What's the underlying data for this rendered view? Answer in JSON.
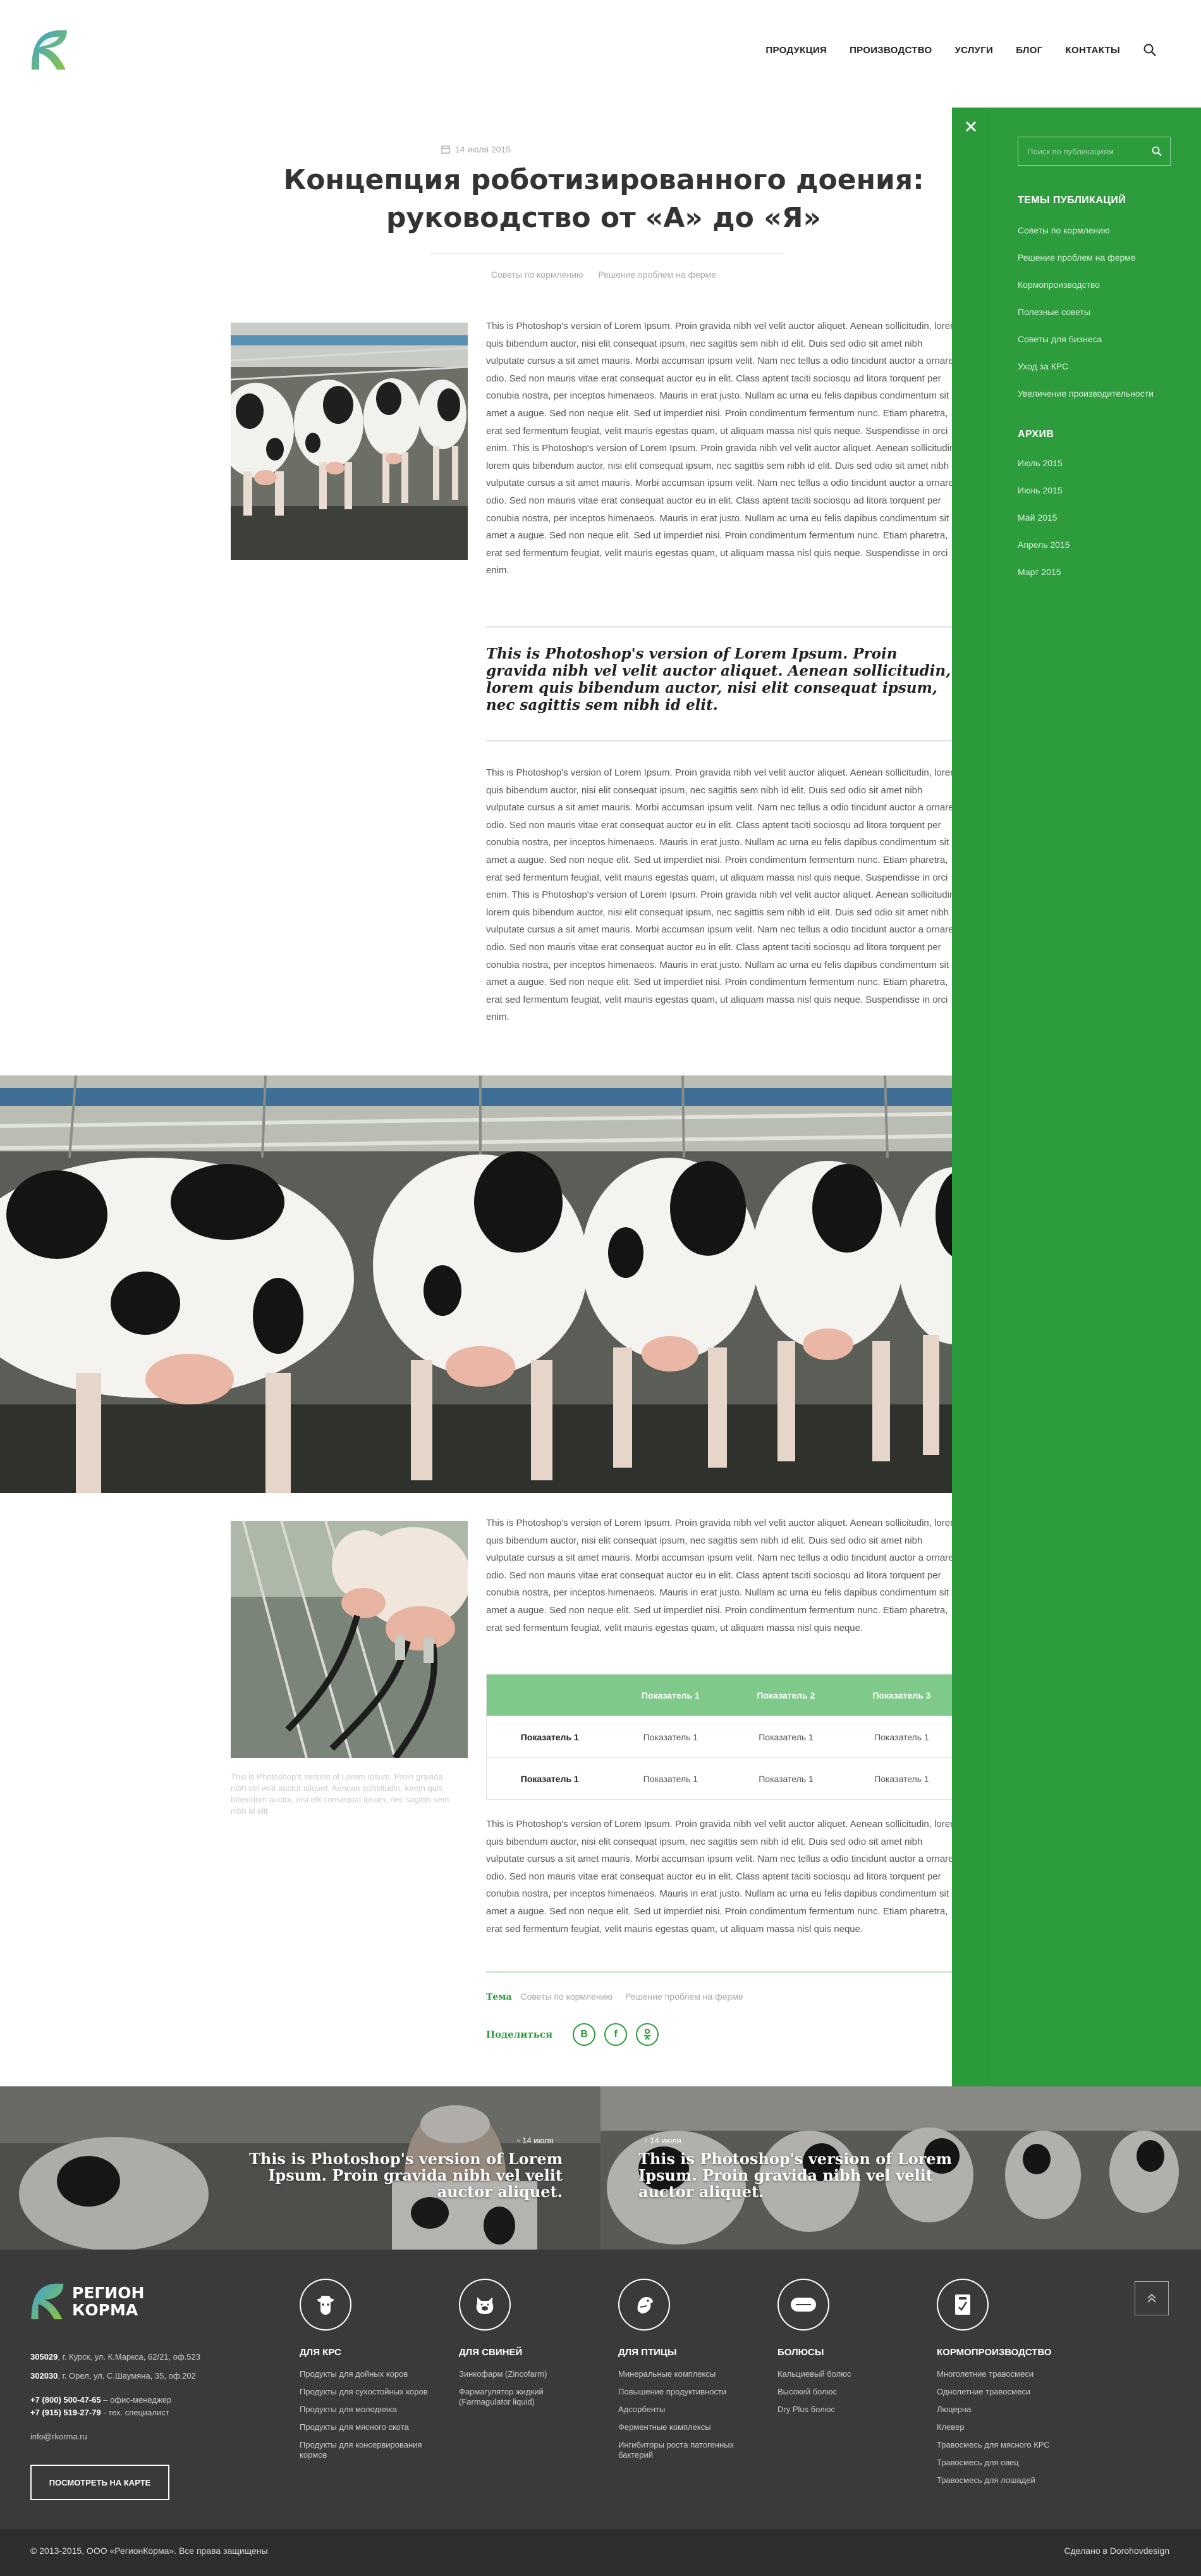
{
  "header": {
    "nav": [
      "ПРОДУКЦИЯ",
      "ПРОИЗВОДСТВО",
      "УСЛУГИ",
      "БЛОГ",
      "КОНТАКТЫ"
    ]
  },
  "article": {
    "date": "14 июля 2015",
    "title_1": "Концепция роботизированного доения:",
    "title_2": "руководство от «А» до «Я»",
    "tags": [
      "Советы по кормлению",
      "Решение проблем на ферме"
    ],
    "para_1": "This is Photoshop's version  of Lorem Ipsum. Proin gravida nibh vel velit auctor aliquet. Aenean sollicitudin, lorem quis bibendum auctor, nisi elit consequat ipsum, nec sagittis sem nibh id elit. Duis sed odio sit amet nibh vulputate cursus a sit amet mauris. Morbi accumsan ipsum velit. Nam nec tellus a odio tincidunt auctor a ornare odio. Sed non  mauris vitae erat consequat auctor eu in elit. Class aptent taciti sociosqu ad litora torquent per conubia nostra, per inceptos himenaeos. Mauris in erat justo. Nullam ac urna eu felis dapibus condimentum sit amet a augue. Sed non neque elit. Sed ut imperdiet nisi. Proin condimentum fermentum nunc. Etiam pharetra, erat sed fermentum feugiat, velit mauris egestas quam, ut aliquam massa nisl quis neque. Suspendisse in orci enim. This is Photoshop's version  of Lorem Ipsum. Proin gravida nibh vel velit auctor aliquet. Aenean sollicitudin, lorem quis bibendum auctor, nisi elit consequat ipsum, nec sagittis sem nibh id elit. Duis sed odio sit amet nibh vulputate cursus a sit amet mauris. Morbi accumsan ipsum velit. Nam nec tellus a odio tincidunt auctor a ornare odio. Sed non  mauris vitae erat consequat auctor eu in elit. Class aptent taciti sociosqu ad litora torquent per conubia nostra, per inceptos himenaeos. Mauris in erat justo. Nullam ac urna eu felis dapibus condimentum sit amet a augue. Sed non neque elit. Sed ut imperdiet nisi. Proin condimentum fermentum nunc. Etiam pharetra, erat sed fermentum feugiat, velit mauris egestas quam, ut aliquam massa nisl quis neque. Suspendisse in orci enim.",
    "quote": "This is Photoshop's version  of Lorem Ipsum. Proin gravida nibh vel velit auctor aliquet. Aenean sollicitudin, lorem quis bibendum auctor, nisi elit consequat ipsum, nec sagittis sem nibh id elit.",
    "para_2": "This is Photoshop's version  of Lorem Ipsum. Proin gravida nibh vel velit auctor aliquet. Aenean sollicitudin, lorem quis bibendum auctor, nisi elit consequat ipsum, nec sagittis sem nibh id elit. Duis sed odio sit amet nibh vulputate cursus a sit amet mauris. Morbi accumsan ipsum velit. Nam nec tellus a odio tincidunt auctor a ornare odio. Sed non  mauris vitae erat consequat auctor eu in elit. Class aptent taciti sociosqu ad litora torquent per conubia nostra, per inceptos himenaeos. Mauris in erat justo. Nullam ac urna eu felis dapibus condimentum sit amet a augue. Sed non neque elit. Sed ut imperdiet nisi. Proin condimentum fermentum nunc. Etiam pharetra, erat sed fermentum feugiat, velit mauris egestas quam, ut aliquam massa nisl quis neque. Suspendisse in orci enim. This is Photoshop's version  of Lorem Ipsum. Proin gravida nibh vel velit auctor aliquet. Aenean sollicitudin, lorem quis bibendum auctor, nisi elit consequat ipsum, nec sagittis sem nibh id elit. Duis sed odio sit amet nibh vulputate cursus a sit amet mauris. Morbi accumsan ipsum velit. Nam nec tellus a odio tincidunt auctor a ornare odio. Sed non  mauris vitae erat consequat auctor eu in elit. Class aptent taciti sociosqu ad litora torquent per conubia nostra, per inceptos himenaeos. Mauris in erat justo. Nullam ac urna eu felis dapibus condimentum sit amet a augue. Sed non neque elit. Sed ut imperdiet nisi. Proin condimentum fermentum nunc. Etiam pharetra, erat sed fermentum feugiat, velit mauris egestas quam, ut aliquam massa nisl quis neque. Suspendisse in orci enim.",
    "para_3": "This is Photoshop's version  of Lorem Ipsum. Proin gravida nibh vel velit auctor aliquet. Aenean sollicitudin, lorem quis bibendum auctor, nisi elit consequat ipsum, nec sagittis sem nibh id elit. Duis sed odio sit amet nibh vulputate cursus a sit amet mauris. Morbi accumsan ipsum velit. Nam nec tellus a odio tincidunt auctor a ornare odio. Sed non  mauris vitae erat consequat auctor eu in elit. Class aptent taciti sociosqu ad litora torquent per conubia nostra, per inceptos himenaeos. Mauris in erat justo. Nullam ac urna eu felis dapibus condimentum sit amet a augue. Sed non neque elit. Sed ut imperdiet nisi. Proin condimentum fermentum nunc. Etiam pharetra, erat sed fermentum feugiat, velit mauris egestas quam, ut aliquam massa nisl quis neque.",
    "caption": "This is Photoshop's version  of Lorem Ipsum. Proin gravida nibh vel velit auctor aliquet. Aenean sollicitudin, lorem quis bibendum auctor, nisi elit consequat ipsum, nec sagittis sem nibh id elit.",
    "table": {
      "headers": [
        "",
        "Показатель 1",
        "Показатель 2",
        "Показатель 3"
      ],
      "rows": [
        [
          "Показатель 1",
          "Показатель 1",
          "Показатель 1",
          "Показатель 1"
        ],
        [
          "Показатель 1",
          "Показатель 1",
          "Показатель 1",
          "Показатель 1"
        ]
      ]
    },
    "para_4": "This is Photoshop's version  of Lorem Ipsum. Proin gravida nibh vel velit auctor aliquet. Aenean sollicitudin, lorem quis bibendum auctor, nisi elit consequat ipsum, nec sagittis sem nibh id elit. Duis sed odio sit amet nibh vulputate cursus a sit amet mauris. Morbi accumsan ipsum velit. Nam nec tellus a odio tincidunt auctor a ornare odio. Sed non  mauris vitae erat consequat auctor eu in elit. Class aptent taciti sociosqu ad litora torquent per conubia nostra, per inceptos himenaeos. Mauris in erat justo. Nullam ac urna eu felis dapibus condimentum sit amet a augue. Sed non neque elit. Sed ut imperdiet nisi. Proin condimentum fermentum nunc. Etiam pharetra, erat sed fermentum feugiat, velit mauris egestas quam, ut aliquam massa nisl quis neque.",
    "tema_label": "Тема",
    "tema_tags": [
      "Советы по кормлению",
      "Решение проблем на ферме"
    ],
    "share_label": "Поделиться",
    "share_icons": [
      "В",
      "f",
      "ok"
    ]
  },
  "sidebar": {
    "search_placeholder": "Поиск по публикациям",
    "topics_title": "ТЕМЫ ПУБЛИКАЦИЙ",
    "topics": [
      "Советы по кормлению",
      "Решение проблем на ферме",
      "Кормопроизводство",
      "Полезные советы",
      "Советы для бизнеса",
      "Уход за КРС",
      "Увеличение производительности"
    ],
    "archive_title": "АРХИВ",
    "archive": [
      "Июль 2015",
      "Июнь 2015",
      "Май 2015",
      "Апрель 2015",
      "Март 2015"
    ]
  },
  "related": [
    {
      "date": "14 июля",
      "text": "This is Photoshop's version  of Lorem Ipsum. Proin gravida nibh vel velit auctor aliquet."
    },
    {
      "date": "14 июля",
      "text": "This is Photoshop's version  of Lorem Ipsum. Proin gravida nibh vel velit auctor aliquet."
    }
  ],
  "footer": {
    "logo_1": "РЕГИОН",
    "logo_2": "КОРМА",
    "addr_1_bold": "305029",
    "addr_1": ", г. Курск, ул. К.Маркса, 62/21, оф.523",
    "addr_2_bold": "302030",
    "addr_2": ", г. Орел, ул. С.Шаумяна, 35, оф.202",
    "phone_1_bold": "+7 (800) 500-47-65",
    "phone_1": " – офис-менеджер",
    "phone_2_bold": "+7 (915) 519-27-79",
    "phone_2": " - тех. специалист",
    "email": "info@rkorma.ru",
    "map_button": "ПОСМОТРЕТЬ НА КАРТЕ",
    "columns": [
      {
        "title": "ДЛЯ КРС",
        "icon": "cow-icon",
        "items": [
          "Продукты для дойных коров",
          "Продукты для сухостойных коров",
          "Продукты для молодняка",
          "Продукты для мясного скота",
          "Продукты для консервирования кормов"
        ]
      },
      {
        "title": "ДЛЯ СВИНЕЙ",
        "icon": "pig-icon",
        "items": [
          "Зинкофарм (Zincofarm)",
          "Фармагулятор жидкий (Farmagulator liquid)"
        ]
      },
      {
        "title": "ДЛЯ ПТИЦЫ",
        "icon": "bird-icon",
        "items": [
          "Минеральные комплексы",
          "Повышение продуктивности",
          "Адсорбенты",
          "Ферментные комплексы",
          "Ингибиторы роста патогенных бактерий"
        ]
      },
      {
        "title": "БОЛЮСЫ",
        "icon": "bolus-icon",
        "items": [
          "Кальциевый болюс",
          "Высокий болюс",
          "Dry Plus болюс"
        ]
      },
      {
        "title": "КОРМОПРОИЗВОДСТВО",
        "icon": "seed-icon",
        "items": [
          "Многолетние травосмеси",
          "Однолетние травосмеси",
          "Люцерна",
          "Клевер",
          "Травосмесь для мясного КРС",
          "Травосмесь для овец",
          "Травосмесь для лошадей"
        ]
      }
    ],
    "copyright": "© 2013-2015, ООО «РегионКорма». Все права защищены",
    "credit": "Сделано в Dorohovdesign"
  },
  "colors": {
    "brand_green": "#2a9a3b",
    "table_green": "#7fc98a",
    "footer_bg": "#3a3a3a"
  }
}
